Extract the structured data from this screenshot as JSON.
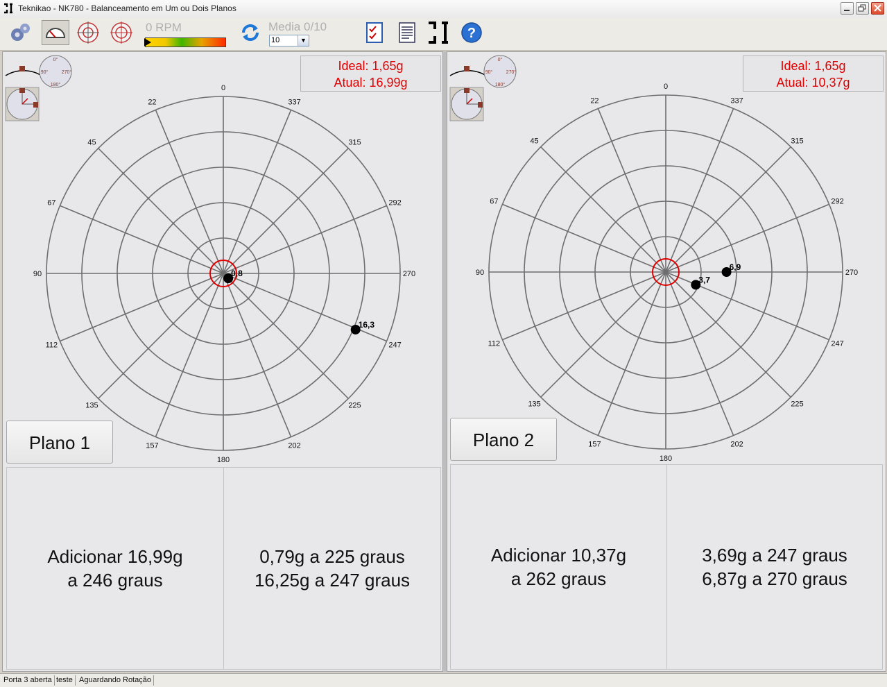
{
  "window": {
    "title": "Teknikao - NK780 - Balanceamento em Um ou Dois Planos"
  },
  "toolbar": {
    "icons": [
      "settings-gears-icon",
      "gauge-icon",
      "target-crosshair-icon",
      "target-crosshair-red-icon",
      "refresh-icon",
      "checklist-icon",
      "report-icon",
      "teknikao-logo-icon",
      "help-icon"
    ],
    "rpm_text": "0 RPM",
    "rpm_level": 0,
    "media_text": "Media 0/10",
    "media_select_value": "10"
  },
  "mini_icon_labels": {
    "top": "0°",
    "left": "90°",
    "right": "270°",
    "bottom": "180°"
  },
  "angle_labels": [
    "0",
    "22",
    "45",
    "67",
    "90",
    "112",
    "135",
    "157",
    "180",
    "202",
    "225",
    "247",
    "270",
    "292",
    "315",
    "337"
  ],
  "plane1": {
    "ideal": "Ideal: 1,65g",
    "atual": "Atual: 16,99g",
    "button": "Plano 1",
    "result_left": [
      "Adicionar 16,99g",
      "a 246 graus"
    ],
    "result_right": [
      "0,79g a 225 graus",
      "16,25g a 247 graus"
    ],
    "points": [
      {
        "label": "16,3",
        "angle": 247,
        "magnitude": 16.25
      },
      {
        "label": "0,8",
        "angle": 225,
        "magnitude": 0.79
      }
    ]
  },
  "plane2": {
    "ideal": "Ideal: 1,65g",
    "atual": "Atual: 10,37g",
    "button": "Plano 2",
    "result_left": [
      "Adicionar 10,37g",
      "a 262 graus"
    ],
    "result_right": [
      "3,69g a 247 graus",
      "6,87g a 270 graus"
    ],
    "points": [
      {
        "label": "6,9",
        "angle": 270,
        "magnitude": 6.87
      },
      {
        "label": "3,7",
        "angle": 247,
        "magnitude": 3.69
      }
    ]
  },
  "status": {
    "port": "Porta 3 aberta",
    "name": "teste",
    "state": "Aguardando Rotação"
  },
  "colors": {
    "readout": "#e00000",
    "center_ring": "#e00000"
  }
}
